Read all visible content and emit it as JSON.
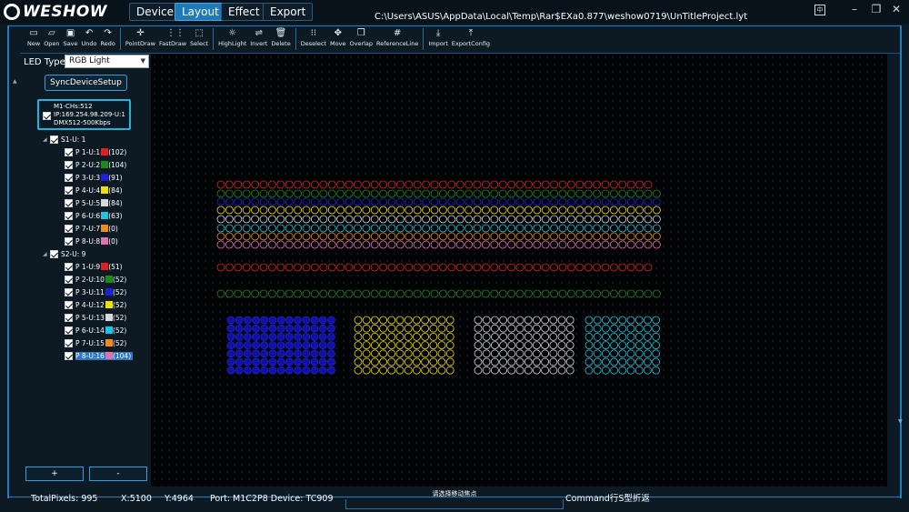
{
  "app": {
    "logo_text": "WESHOW",
    "file_path": "C:\\Users\\ASUS\\AppData\\Local\\Temp\\Rar$EXa0.877\\weshow0719\\UnTitleProject.lyt",
    "lang_label": "中"
  },
  "menu_tabs": [
    {
      "label": "Device",
      "active": false
    },
    {
      "label": "Layout",
      "active": true
    },
    {
      "label": "Effect",
      "active": false
    },
    {
      "label": "Export",
      "active": false
    }
  ],
  "toolbar": {
    "groups": [
      [
        {
          "label": "New",
          "icon": "new-file-icon",
          "glyph": "▭"
        },
        {
          "label": "Open",
          "icon": "open-folder-icon",
          "glyph": "▱"
        },
        {
          "label": "Save",
          "icon": "save-icon",
          "glyph": "▣"
        },
        {
          "label": "Undo",
          "icon": "undo-icon",
          "glyph": "↶"
        },
        {
          "label": "Redo",
          "icon": "redo-icon",
          "glyph": "↷"
        }
      ],
      [
        {
          "label": "PointDraw",
          "icon": "point-draw-icon",
          "glyph": "✛"
        },
        {
          "label": "FastDraw",
          "icon": "fast-draw-icon",
          "glyph": "⋮⋮"
        },
        {
          "label": "Select",
          "icon": "select-icon",
          "glyph": "⬚"
        }
      ],
      [
        {
          "label": "HighLight",
          "icon": "highlight-icon",
          "glyph": "☼"
        },
        {
          "label": "Invert",
          "icon": "invert-icon",
          "glyph": "⇌"
        },
        {
          "label": "Delete",
          "icon": "delete-icon",
          "glyph": "🗑"
        }
      ],
      [
        {
          "label": "Deselect",
          "icon": "deselect-icon",
          "glyph": "⁝⁝"
        },
        {
          "label": "Move",
          "icon": "move-icon",
          "glyph": "✥"
        },
        {
          "label": "Overlap",
          "icon": "overlap-icon",
          "glyph": "❐"
        },
        {
          "label": "ReferenceLine",
          "icon": "reference-line-icon",
          "glyph": "#"
        }
      ],
      [
        {
          "label": "Import",
          "icon": "import-icon",
          "glyph": "⤓"
        },
        {
          "label": "ExportConfig",
          "icon": "export-config-icon",
          "glyph": "⤒"
        }
      ]
    ]
  },
  "left_panel": {
    "led_type_label": "LED Type",
    "led_type_value": "RGB Light",
    "sync_button": "SyncDeviceSetup",
    "device": {
      "line1": "M1-CHs:512",
      "line2": "IP:169.254.98.209-U:1",
      "line3": "DMX512-500Kbps"
    },
    "tree": [
      {
        "kind": "group",
        "label": "S1-U: 1"
      },
      {
        "kind": "port",
        "label": "P 1-U:1",
        "color": "#e01f1f",
        "count": "(102)"
      },
      {
        "kind": "port",
        "label": "P 2-U:2",
        "color": "#1a8a1a",
        "count": "(104)"
      },
      {
        "kind": "port",
        "label": "P 3-U:3",
        "color": "#1f1fd8",
        "count": "(91)"
      },
      {
        "kind": "port",
        "label": "P 4-U:4",
        "color": "#f0e000",
        "count": "(84)"
      },
      {
        "kind": "port",
        "label": "P 5-U:5",
        "color": "#d8d8d8",
        "count": "(84)"
      },
      {
        "kind": "port",
        "label": "P 6-U:6",
        "color": "#19c8e0",
        "count": "(63)"
      },
      {
        "kind": "port",
        "label": "P 7-U:7",
        "color": "#f08a1a",
        "count": "(0)"
      },
      {
        "kind": "port",
        "label": "P 8-U:8",
        "color": "#e070b0",
        "count": "(0)"
      },
      {
        "kind": "group",
        "label": "S2-U: 9"
      },
      {
        "kind": "port",
        "label": "P 1-U:9",
        "color": "#e01f1f",
        "count": "(51)"
      },
      {
        "kind": "port",
        "label": "P 2-U:10",
        "color": "#1a8a1a",
        "count": "(52)"
      },
      {
        "kind": "port",
        "label": "P 3-U:11",
        "color": "#1f1fd8",
        "count": "(52)"
      },
      {
        "kind": "port",
        "label": "P 4-U:12",
        "color": "#f0e000",
        "count": "(52)"
      },
      {
        "kind": "port",
        "label": "P 5-U:13",
        "color": "#d8d8d8",
        "count": "(52)"
      },
      {
        "kind": "port",
        "label": "P 6-U:14",
        "color": "#19c8e0",
        "count": "(52)"
      },
      {
        "kind": "port",
        "label": "P 7-U:15",
        "color": "#f08a1a",
        "count": "(52)"
      },
      {
        "kind": "port",
        "label": "P 8-U:16",
        "color": "#e070b0",
        "count": "(104)",
        "selected": true
      }
    ],
    "plus_label": "+",
    "minus_label": "-"
  },
  "canvas": {
    "strips": [
      {
        "color": "#e01f1f",
        "count": 51
      },
      {
        "color": "#1a8a1a",
        "count": 52
      },
      {
        "color": "#1f1fd8",
        "count": 52
      },
      {
        "color": "#f0e000",
        "count": 52
      },
      {
        "color": "#d8d8d8",
        "count": 52
      },
      {
        "color": "#19c8e0",
        "count": 52
      },
      {
        "color": "#f08a1a",
        "count": 52
      },
      {
        "color": "#e070b0",
        "count": 52
      },
      {
        "color": "#e01f1f",
        "count": 51
      },
      {
        "color": "#1a8a1a",
        "count": 52
      }
    ],
    "blocks": [
      {
        "color": "#1f1fd8",
        "cols": 13,
        "rows": 7
      },
      {
        "color": "#f0e000",
        "cols": 12,
        "rows": 7
      },
      {
        "color": "#d8d8d8",
        "cols": 12,
        "rows": 7
      },
      {
        "color": "#19c8e0",
        "cols": 9,
        "rows": 7
      }
    ]
  },
  "status": {
    "total_pixels": "TotalPixels:   995",
    "x": "X:5100",
    "y": "Y:4964",
    "port": "Port:  M1C2P8 Device:  TC909",
    "hint": "请选择移动焦点",
    "command": "Command行S型折返"
  }
}
